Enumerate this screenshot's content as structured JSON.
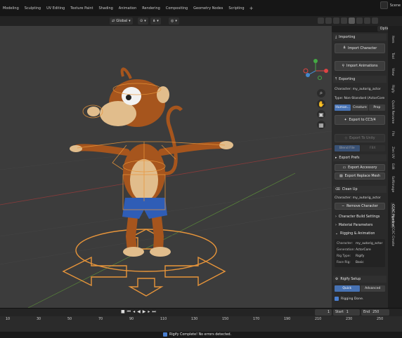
{
  "workspace_tabs": [
    "Modeling",
    "Sculpting",
    "UV Editing",
    "Texture Paint",
    "Shading",
    "Animation",
    "Rendering",
    "Compositing",
    "Geometry Nodes",
    "Scripting",
    "+"
  ],
  "scene_label": "Scene",
  "header": {
    "orientation": "Global",
    "options_label": "Options"
  },
  "panel": {
    "importing_header": "Importing",
    "import_character": "Import Character",
    "import_animations": "Import Animations",
    "exporting_header": "Exporting",
    "character_line": "Character: my_autorig_actor",
    "type_line": "Type: Non-Standard (ActorCore",
    "type_buttons": [
      "Human...",
      "Creature",
      "Prop"
    ],
    "export_cc34": "Export to CC3/4",
    "export_unity": "Export To Unity",
    "unity_options": [
      "Blend File",
      "FBX"
    ],
    "export_prefs": "Export Prefs",
    "export_accessory": "Export Accessory",
    "export_replace_mesh": "Export Replace Mesh",
    "clean_up_header": "Clean Up",
    "cleanup_character": "Character: my_autorig_actor",
    "remove_character": "Remove Character",
    "character_build_settings": "Character Build Settings",
    "material_parameters": "Material Parameters",
    "rigging_animation": "Rigging & Animation",
    "info_rows": [
      {
        "k": "Character:",
        "v": "my_autorig_actor"
      },
      {
        "k": "Generation:",
        "v": "ActorCore"
      },
      {
        "k": "Rig Type:",
        "v": "Rigify"
      },
      {
        "k": "Face Rig:",
        "v": "Basic"
      }
    ],
    "rigify_setup": "Rigify Setup",
    "rigify_modes": [
      "Quick",
      "Advanced"
    ],
    "rigging_done": "Rigging Done."
  },
  "side_tabs": [
    "Item",
    "Tool",
    "View",
    "Rigfy",
    "Quick Rename",
    "Ftn",
    "Zen UV",
    "Edit",
    "Softimage",
    "CC/iC Pipeline",
    "CC/iC Create"
  ],
  "timeline": {
    "current_frame": "1",
    "start_label": "Start",
    "start_value": "1",
    "end_label": "End",
    "end_value": "250",
    "ticks": [
      "10",
      "30",
      "50",
      "70",
      "90",
      "110",
      "130",
      "150",
      "170",
      "190",
      "210",
      "230",
      "250"
    ]
  },
  "status_message": "Rigify Complete! No errors detected.",
  "colors": {
    "accent": "#4772b3",
    "viewport": "#3c3c3c",
    "monkey_fur": "#a6551d",
    "monkey_skin": "#e1bd8c",
    "shorts": "#2f5db6",
    "rig_orange": "#e8953a"
  }
}
